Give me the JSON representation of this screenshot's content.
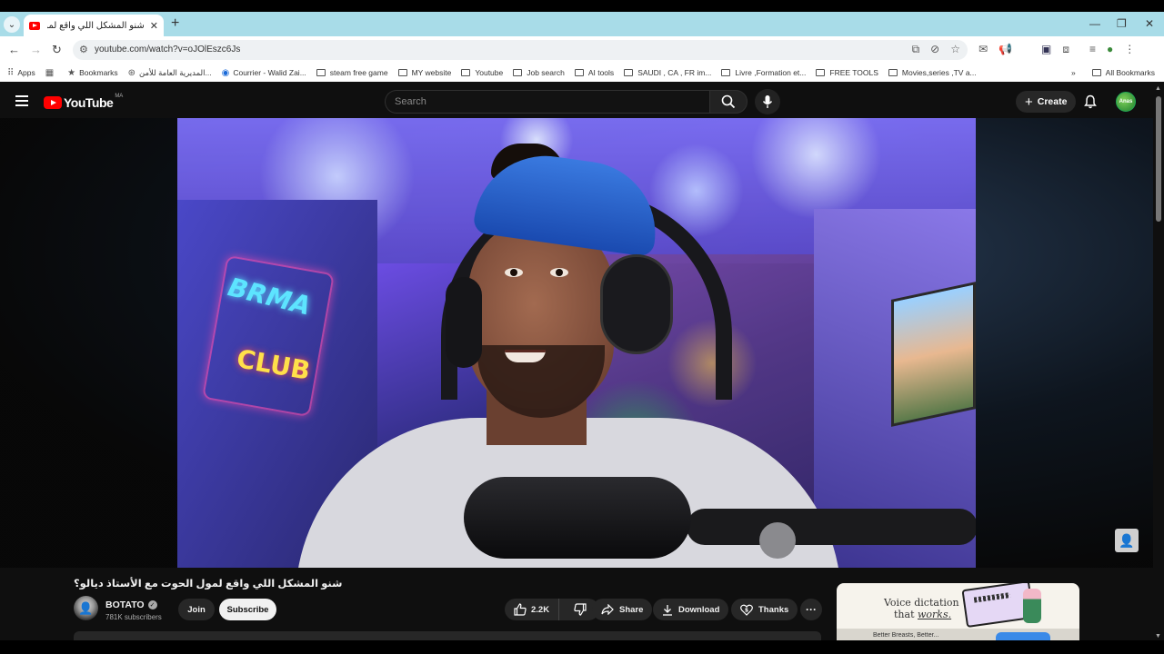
{
  "browser": {
    "tab_title": "شنو المشكل اللي واقع لمول الحوت مع الأستاذ ديالو؟ - YouTube",
    "tab_title_short": "شنو المشكل اللي واقع لمول الح",
    "url": "youtube.com/watch?v=oJOlEszc6Js",
    "bookmarks": [
      {
        "label": "Apps",
        "icon": "apps-grid-icon"
      },
      {
        "label": "Bookmarks",
        "icon": "star-icon"
      },
      {
        "label": "المديرية العامة للأمن...",
        "icon": "globe-icon"
      },
      {
        "label": "Courrier - Walid Zai...",
        "icon": "outlook-icon"
      },
      {
        "label": "steam free game",
        "icon": "folder-icon"
      },
      {
        "label": "MY website",
        "icon": "folder-icon"
      },
      {
        "label": "Youtube",
        "icon": "folder-icon"
      },
      {
        "label": "Job search",
        "icon": "folder-icon"
      },
      {
        "label": "AI tools",
        "icon": "folder-icon"
      },
      {
        "label": "SAUDI , CA , FR im...",
        "icon": "folder-icon"
      },
      {
        "label": "Livre ,Formation et...",
        "icon": "folder-icon"
      },
      {
        "label": "FREE TOOLS",
        "icon": "folder-icon"
      },
      {
        "label": "Movies,series ,TV a...",
        "icon": "folder-icon"
      }
    ],
    "all_bookmarks": "All Bookmarks",
    "overflow": "»"
  },
  "youtube": {
    "logo_text": "YouTube",
    "country_code": "MA",
    "search_placeholder": "Search",
    "create_label": "Create",
    "avatar_text": "Anas"
  },
  "video": {
    "neon_line1": "BRMA",
    "neon_line2": "CLUB",
    "title": "شنو المشكل اللي واقع لمول الحوت مع الأستاذ ديالو؟",
    "channel_name": "BOTATO",
    "subscribers": "781K subscribers",
    "join_label": "Join",
    "subscribe_label": "Subscribe",
    "likes": "2.2K",
    "share_label": "Share",
    "download_label": "Download",
    "thanks_label": "Thanks",
    "more_label": "···"
  },
  "ad": {
    "line1": "Voice dictation",
    "line2_prefix": "that ",
    "line2_emph": "works.",
    "footer": "Better Breasts, Better..."
  },
  "colors": {
    "yt_red": "#ff0000",
    "bg": "#0f0f0f",
    "tabstrip": "#a8dce8"
  }
}
